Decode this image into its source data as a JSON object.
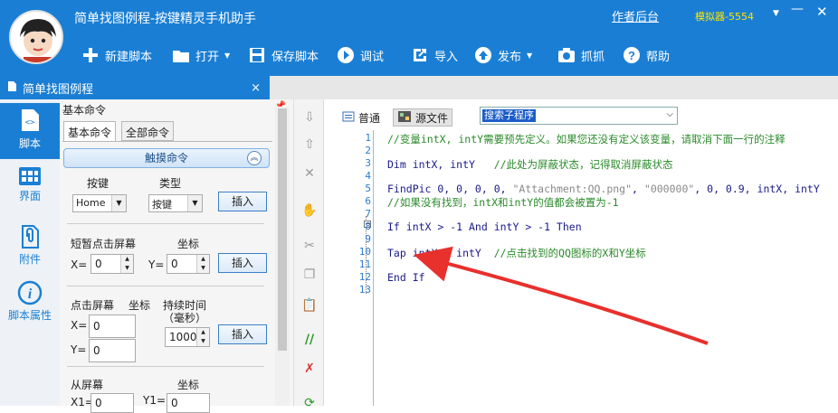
{
  "window": {
    "title": "简单找图例程-按键精灵手机助手",
    "author_link": "作者后台",
    "device": "模拟器-5554"
  },
  "toolbar": [
    {
      "label": "新建脚本",
      "icon": "plus-icon"
    },
    {
      "label": "打开",
      "icon": "folder-icon",
      "dropdown": true
    },
    {
      "label": "保存脚本",
      "icon": "save-icon"
    },
    {
      "label": "调试",
      "icon": "play-icon"
    },
    {
      "label": "导入",
      "icon": "import-icon"
    },
    {
      "label": "发布",
      "icon": "publish-icon",
      "dropdown": true
    },
    {
      "label": "抓抓",
      "icon": "camera-icon"
    },
    {
      "label": "帮助",
      "icon": "help-icon"
    }
  ],
  "file_tab": {
    "label": "简单找图例程",
    "close": "×"
  },
  "left_nav": [
    {
      "label": "脚本",
      "icon": "script-icon",
      "active": true
    },
    {
      "label": "界面",
      "icon": "grid-icon"
    },
    {
      "label": "附件",
      "icon": "attachment-icon"
    },
    {
      "label": "脚本属性",
      "icon": "info-icon"
    }
  ],
  "command_panel": {
    "title": "基本命令",
    "pin": "ₔ",
    "tabs": [
      "基本命令",
      "全部命令"
    ],
    "section": "触摸命令",
    "key": {
      "label_key": "按键",
      "label_type": "类型",
      "key_value": "Home",
      "type_value": "按键",
      "insert": "插入"
    },
    "tap": {
      "label": "短暂点击屏幕",
      "coord_label": "坐标",
      "x_label": "X=",
      "x_value": "0",
      "y_label": "Y=",
      "y_value": "0",
      "insert": "插入"
    },
    "press": {
      "label": "点击屏幕",
      "coord_label": "坐标",
      "duration_label": "持续时间",
      "duration_unit": "（毫秒）",
      "x_label": "X=",
      "x_value": "0",
      "y_label": "Y=",
      "y_value": "0",
      "duration_value": "1000",
      "insert": "插入"
    },
    "swipe": {
      "label": "从屏幕",
      "coord_label": "坐标",
      "x1_label": "X1=",
      "x1_value": "0",
      "y1_label": "Y1=",
      "y1_value": "0"
    }
  },
  "editor": {
    "modes": [
      "普通",
      "源文件"
    ],
    "active_mode": "源文件",
    "sub_combo": "搜索子程序",
    "lines": [
      {
        "n": "1",
        "text": "//变量intX, intY需要预先定义。如果您还没有定义该变量，请取消下面一行的注释"
      },
      {
        "n": "2",
        "text": ""
      },
      {
        "n": "3",
        "text": "Dim intX, intY   //此处为屏蔽状态，记得取消屏蔽状态"
      },
      {
        "n": "4",
        "text": ""
      },
      {
        "n": "5",
        "text": "FindPic 0, 0, 0, 0, \"Attachment:QQ.png\", \"000000\", 0, 0.9, intX, intY"
      },
      {
        "n": "6",
        "text": "//如果没有找到，intX和intY的值都会被置为-1"
      },
      {
        "n": "7",
        "text": ""
      },
      {
        "n": "8",
        "text": "If intX > -1 And intY > -1 Then"
      },
      {
        "n": "9",
        "text": ""
      },
      {
        "n": "10",
        "text": "Tap intX , intY  //点击找到的QQ图标的X和Y坐标"
      },
      {
        "n": "11",
        "text": ""
      },
      {
        "n": "12",
        "text": "End If"
      },
      {
        "n": "13",
        "text": ""
      }
    ]
  },
  "colors": {
    "accent": "#1a7fd4",
    "arrow": "#e8302c",
    "comment": "#2b8a2b",
    "keyword": "#1a1a8c"
  }
}
